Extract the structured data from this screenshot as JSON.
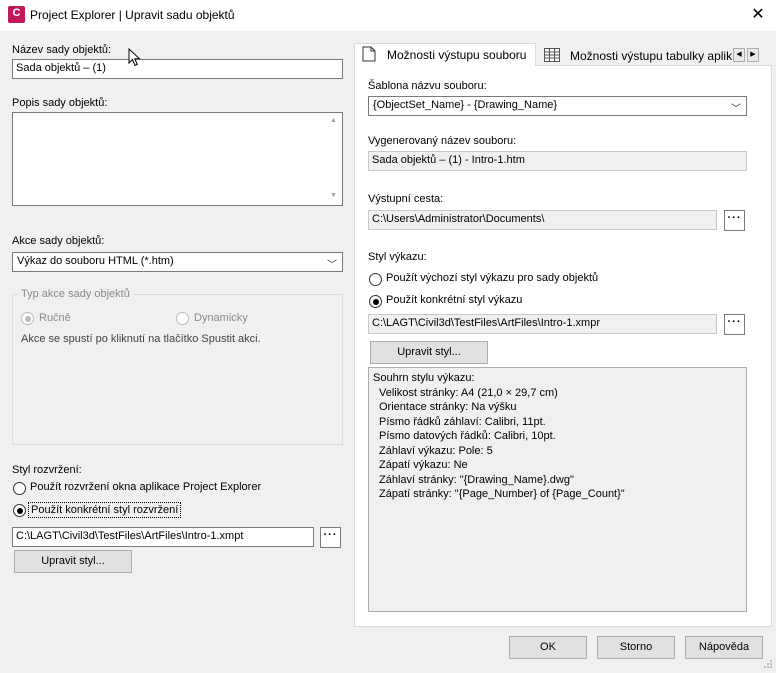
{
  "window": {
    "title": "Project Explorer | Upravit sadu objektů",
    "icon_letter": "C",
    "icon_sub": "CIVIL",
    "close_glyph": "✕"
  },
  "left": {
    "name_label": "Název sady objektů:",
    "name_value": "Sada objektů – (1)",
    "desc_label": "Popis sady objektů:",
    "desc_value": "",
    "action_label": "Akce sady objektů:",
    "action_value": "Výkaz do souboru HTML (*.htm)",
    "type_group": {
      "title": "Typ akce sady objektů",
      "manual": "Ručně",
      "dynamic": "Dynamicky",
      "note": "Akce se spustí po kliknutí na tlačítko Spustit akci."
    },
    "layout_label": "Styl rozvržení:",
    "layout_opt1": "Použít rozvržení okna aplikace Project Explorer",
    "layout_opt2": "Použít konkrétní styl rozvržení",
    "layout_path": "C:\\LAGT\\Civil3d\\TestFiles\\ArtFiles\\Intro-1.xmpt",
    "browse": "···",
    "edit_style": "Upravit styl..."
  },
  "right": {
    "tabs": [
      {
        "label": "Možnosti výstupu souboru"
      },
      {
        "label": "Možnosti výstupu tabulky aplik"
      }
    ],
    "template_label": "Šablona názvu souboru:",
    "template_value": "{ObjectSet_Name} - {Drawing_Name}",
    "generated_label": "Vygenerovaný název souboru:",
    "generated_value": "Sada objektů – (1) - Intro-1.htm",
    "output_label": "Výstupní cesta:",
    "output_value": "C:\\Users\\Administrator\\Documents\\",
    "report_label": "Styl výkazu:",
    "report_opt1": "Použít výchozí styl výkazu pro sady objektů",
    "report_opt2": "Použít konkrétní styl výkazu",
    "report_path": "C:\\LAGT\\Civil3d\\TestFiles\\ArtFiles\\Intro-1.xmpr",
    "browse": "···",
    "edit_style": "Upravit styl...",
    "summary": [
      "Souhrn stylu výkazu:",
      "  Velikost stránky: A4 (21,0 × 29,7 cm)",
      "  Orientace stránky: Na výšku",
      "  Písmo řádků záhlaví: Calibri, 11pt.",
      "  Písmo datových řádků: Calibri, 10pt.",
      "  Záhlaví výkazu: Pole: 5",
      "  Zápatí výkazu: Ne",
      "  Záhlaví stránky: \"{Drawing_Name}.dwg\"",
      "  Zápatí stránky: \"{Page_Number} of {Page_Count}\""
    ]
  },
  "footer": {
    "ok": "OK",
    "cancel": "Storno",
    "help": "Nápověda"
  }
}
